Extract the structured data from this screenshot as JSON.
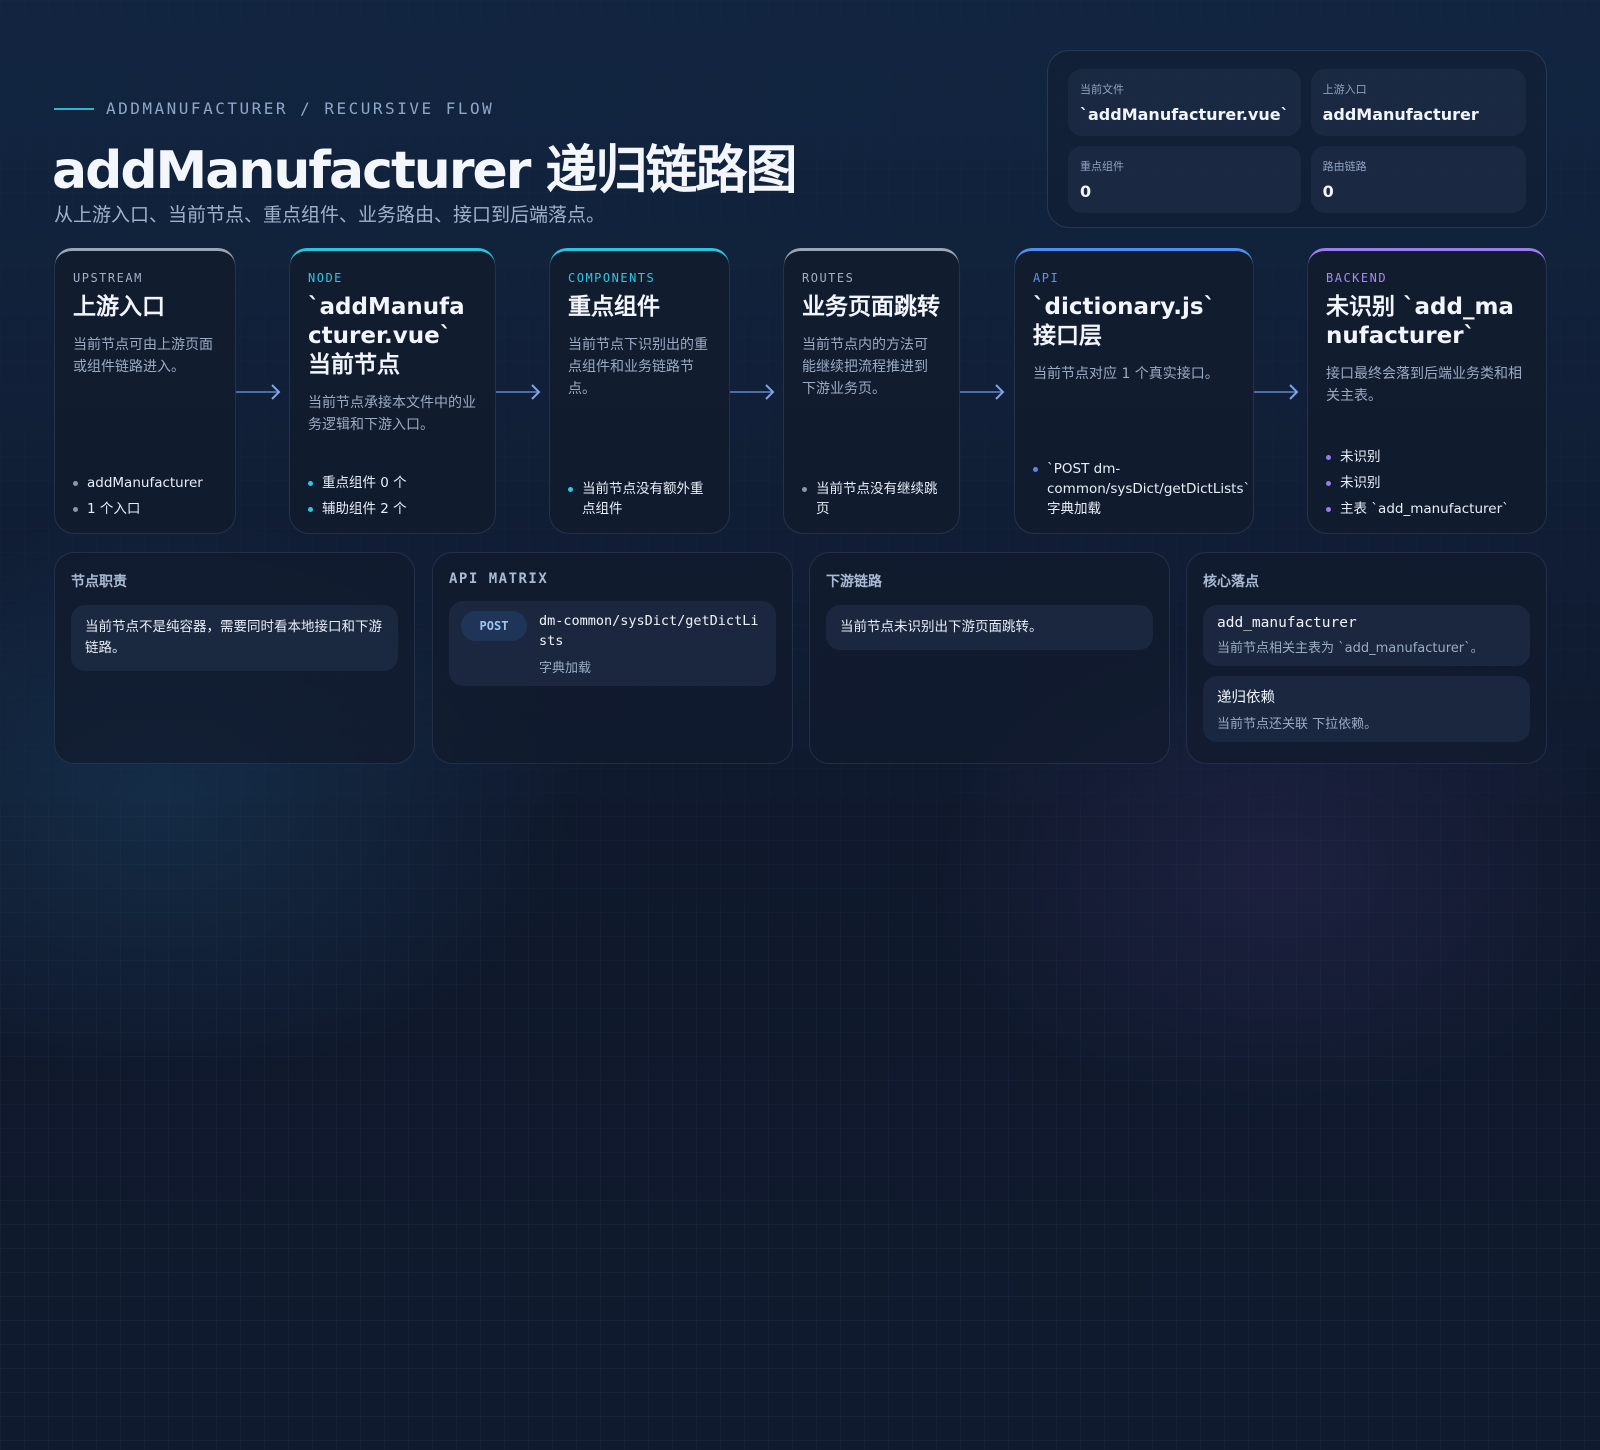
{
  "header": {
    "eyebrow": "ADDMANUFACTURER / RECURSIVE FLOW",
    "title": "addManufacturer 递归链路图",
    "subtitle": "从上游入口、当前节点、重点组件、业务路由、接口到后端落点。"
  },
  "stats": [
    {
      "label": "当前文件",
      "value": "`addManufacturer.vue`"
    },
    {
      "label": "上游入口",
      "value": "addManufacturer"
    },
    {
      "label": "重点组件",
      "value": "0"
    },
    {
      "label": "路由链路",
      "value": "0"
    }
  ],
  "flow": [
    {
      "tag": "UPSTREAM",
      "title": "上游入口",
      "desc": "当前节点可由上游页面或组件链路进入。",
      "items": [
        "addManufacturer",
        "1 个入口"
      ],
      "accent": "#9aa6b8",
      "tag_color": "#9fb0c8",
      "dot_color": "#8b97a8"
    },
    {
      "tag": "NODE",
      "title": "`addManufacturer.vue` 当前节点",
      "desc": "当前节点承接本文件中的业务逻辑和下游入口。",
      "items": [
        "重点组件 0 个",
        "辅助组件 2 个"
      ],
      "accent": "#29c3e0",
      "tag_color": "#2fc6e3",
      "dot_color": "#2fc6e3"
    },
    {
      "tag": "COMPONENTS",
      "title": "重点组件",
      "desc": "当前节点下识别出的重点组件和业务链路节点。",
      "items": [
        "当前节点没有额外重点组件"
      ],
      "accent": "#29c3e0",
      "tag_color": "#2fc6e3",
      "dot_color": "#2fc6e3"
    },
    {
      "tag": "ROUTES",
      "title": "业务页面跳转",
      "desc": "当前节点内的方法可能继续把流程推进到下游业务页。",
      "items": [
        "当前节点没有继续跳页"
      ],
      "accent": "#9aa6b8",
      "tag_color": "#9fb0c8",
      "dot_color": "#8b97a8"
    },
    {
      "tag": "API",
      "title": "`dictionary.js` 接口层",
      "desc": "当前节点对应 1 个真实接口。",
      "items": [
        "`POST dm-common/sysDict/getDictLists` 字典加载"
      ],
      "accent": "#4f8ef0",
      "tag_color": "#5c95f2",
      "dot_color": "#4f8ef0"
    },
    {
      "tag": "BACKEND",
      "title": "未识别 `add_manufacturer`",
      "desc": "接口最终会落到后端业务类和相关主表。",
      "items": [
        "未识别",
        "未识别",
        "主表 `add_manufacturer`"
      ],
      "accent": "#9b7cf0",
      "tag_color": "#a788f4",
      "dot_color": "#9b7cf0"
    }
  ],
  "panels": {
    "duty": {
      "title": "节点职责",
      "note": "当前节点不是纯容器，需要同时看本地接口和下游链路。"
    },
    "api": {
      "title": "API MATRIX",
      "method": "POST",
      "path": "dm-common/sysDict/getDictLists",
      "desc": "字典加载"
    },
    "downstream": {
      "title": "下游链路",
      "note": "当前节点未识别出下游页面跳转。"
    },
    "core": {
      "title": "核心落点",
      "items": [
        {
          "head": "add_manufacturer",
          "sub": "当前节点相关主表为 `add_manufacturer`。"
        },
        {
          "head": "递归依赖",
          "sub": "当前节点还关联 下拉依赖。"
        }
      ]
    }
  }
}
